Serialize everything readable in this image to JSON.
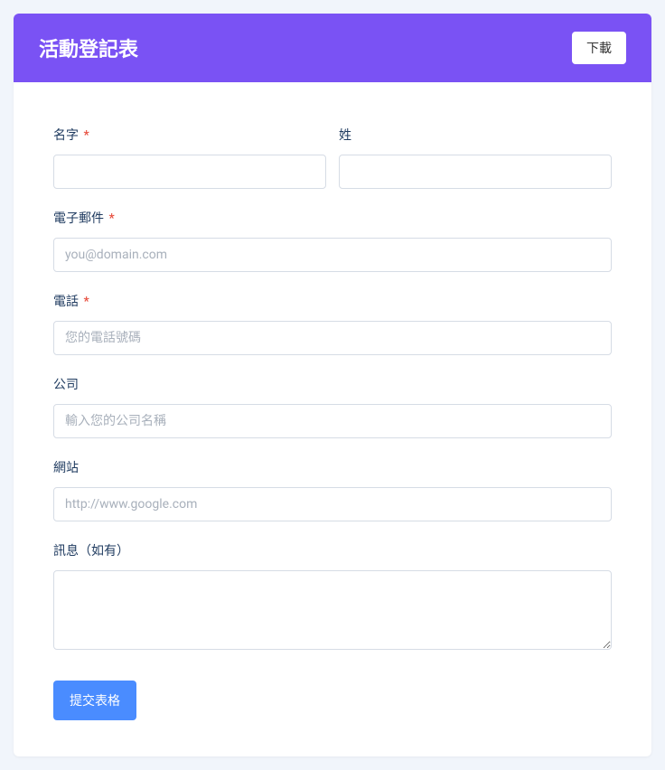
{
  "header": {
    "title": "活動登記表",
    "download_label": "下載"
  },
  "fields": {
    "first_name": {
      "label": "名字",
      "required": "*"
    },
    "last_name": {
      "label": "姓"
    },
    "email": {
      "label": "電子郵件",
      "required": "*",
      "placeholder": "you@domain.com"
    },
    "phone": {
      "label": "電話",
      "required": "*",
      "placeholder": "您的電話號碼"
    },
    "company": {
      "label": "公司",
      "placeholder": "輸入您的公司名稱"
    },
    "website": {
      "label": "網站",
      "placeholder": "http://www.google.com"
    },
    "message": {
      "label": "訊息（如有）"
    }
  },
  "submit": {
    "label": "提交表格"
  }
}
